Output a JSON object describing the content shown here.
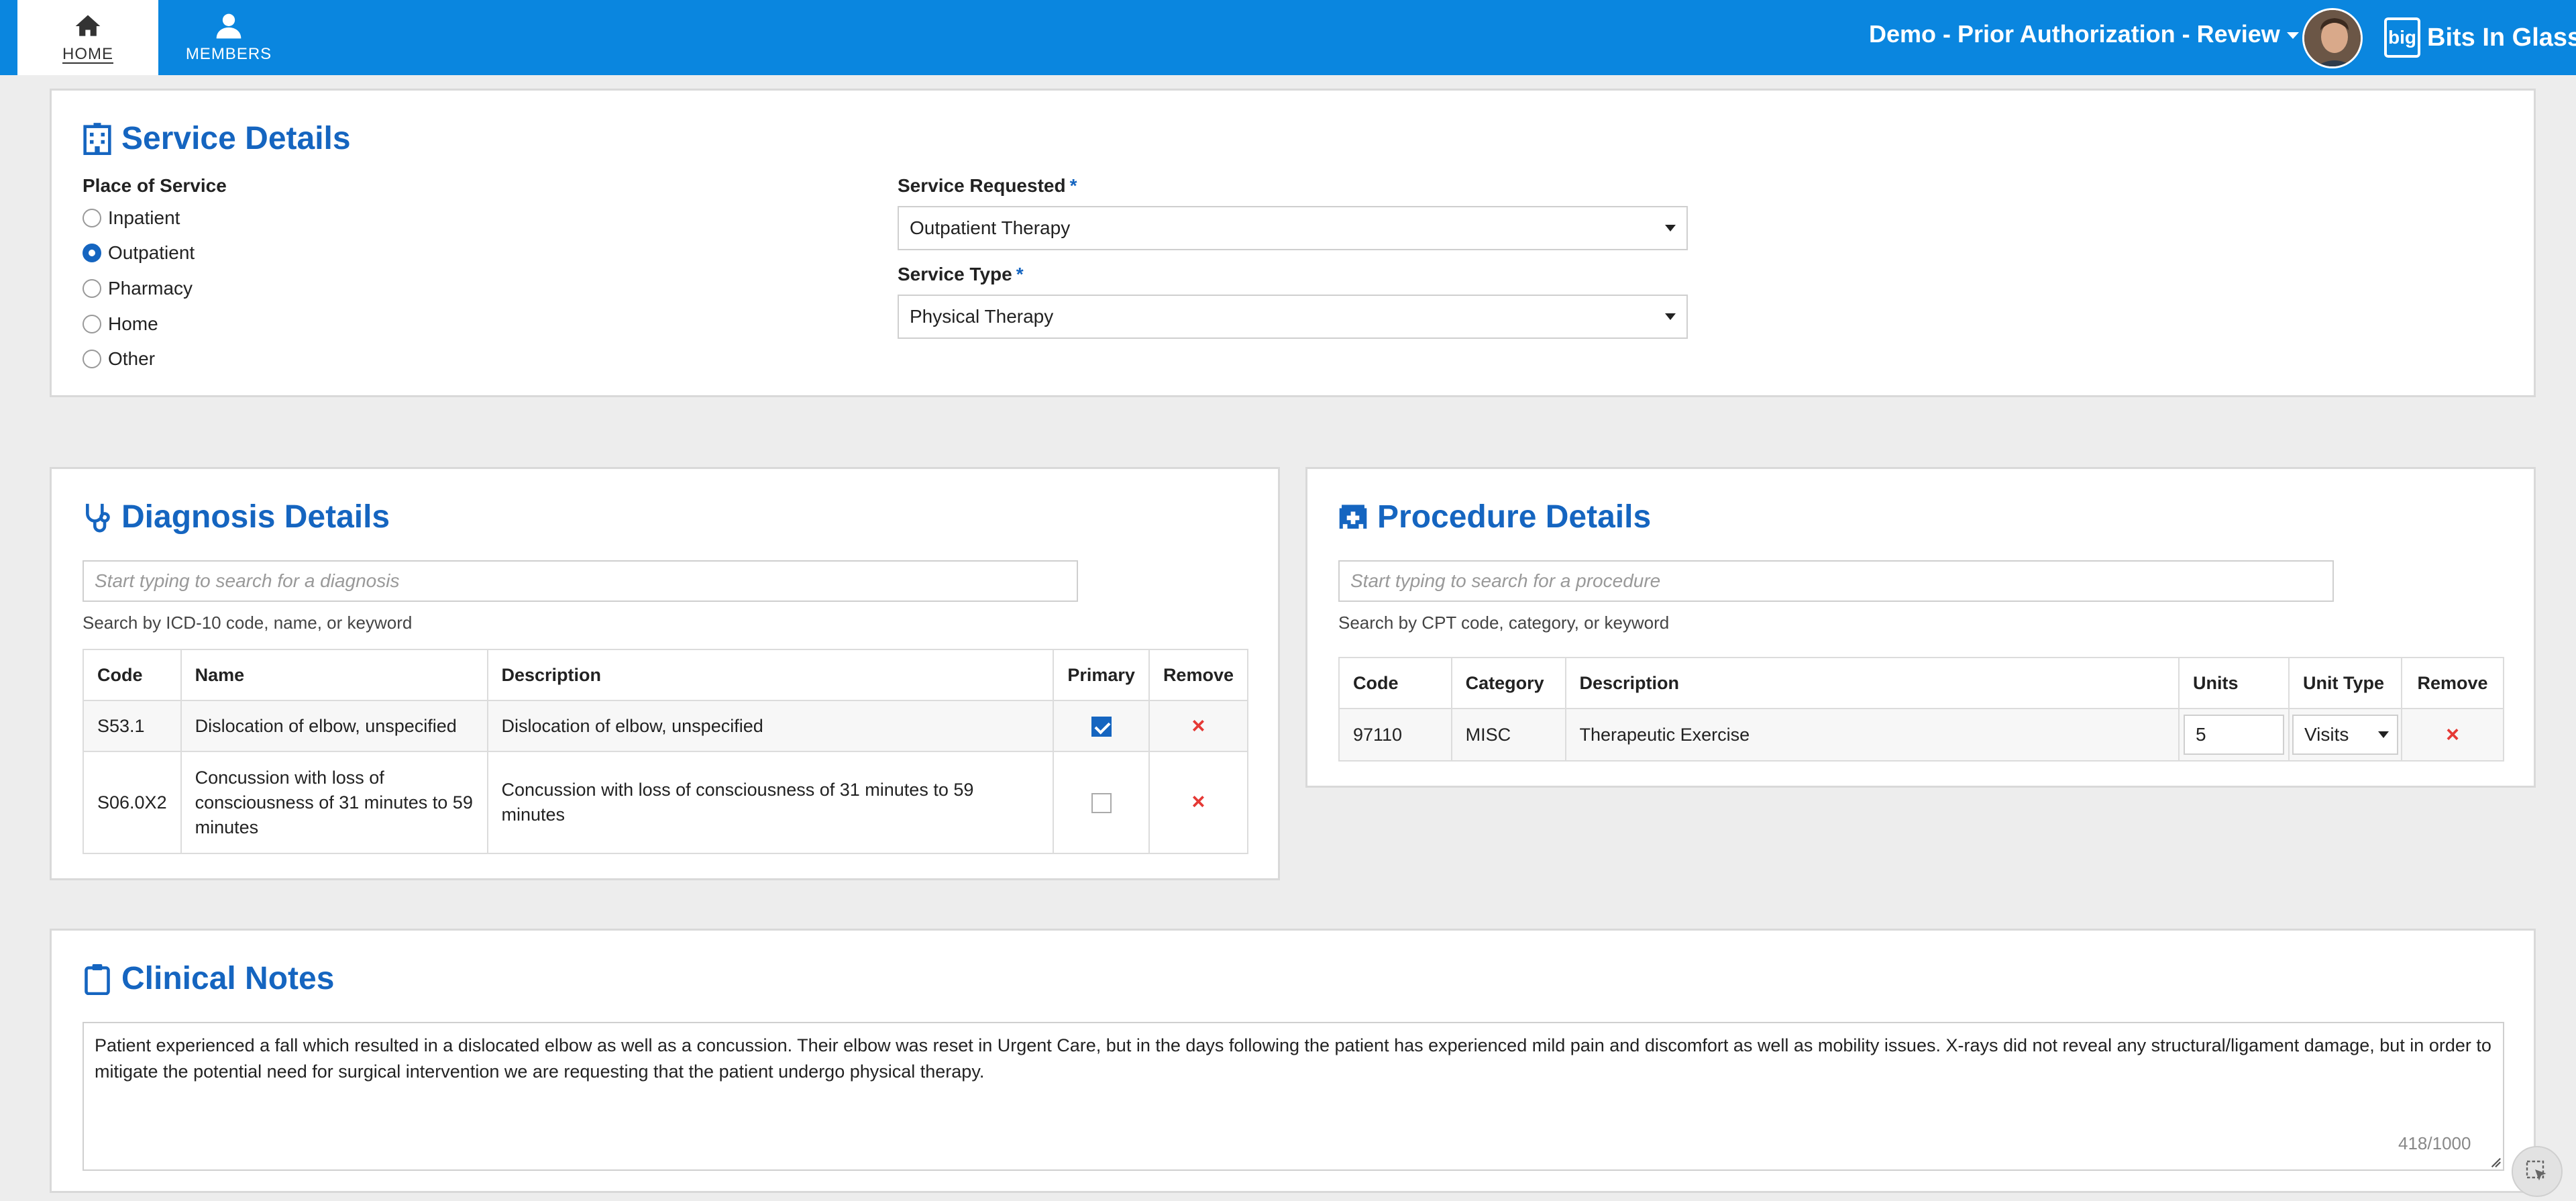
{
  "nav": {
    "home_label": "HOME",
    "members_label": "MEMBERS"
  },
  "header": {
    "app_title": "Demo - Prior Authorization - Review",
    "brand_mark": "big",
    "brand_name": "Bits In Glass"
  },
  "service": {
    "title": "Service Details",
    "place_label": "Place of Service",
    "places": [
      {
        "label": "Inpatient",
        "selected": false
      },
      {
        "label": "Outpatient",
        "selected": true
      },
      {
        "label": "Pharmacy",
        "selected": false
      },
      {
        "label": "Home",
        "selected": false
      },
      {
        "label": "Other",
        "selected": false
      }
    ],
    "requested_label": "Service Requested",
    "requested_value": "Outpatient Therapy",
    "type_label": "Service Type",
    "type_value": "Physical Therapy",
    "required_mark": "*"
  },
  "diagnosis": {
    "title": "Diagnosis Details",
    "search_placeholder": "Start typing to search for a diagnosis",
    "hint": "Search by ICD-10 code, name, or keyword",
    "columns": [
      "Code",
      "Name",
      "Description",
      "Primary",
      "Remove"
    ],
    "rows": [
      {
        "code": "S53.1",
        "name": "Dislocation of elbow, unspecified",
        "description": "Dislocation of elbow, unspecified",
        "primary": true
      },
      {
        "code": "S06.0X2",
        "name": "Concussion with loss of consciousness of 31 minutes to 59 minutes",
        "description": "Concussion with loss of consciousness of 31 minutes to 59 minutes",
        "primary": false
      }
    ]
  },
  "procedure": {
    "title": "Procedure Details",
    "search_placeholder": "Start typing to search for a procedure",
    "hint": "Search by CPT code, category, or keyword",
    "columns": [
      "Code",
      "Category",
      "Description",
      "Units",
      "Unit Type",
      "Remove"
    ],
    "rows": [
      {
        "code": "97110",
        "category": "MISC",
        "description": "Therapeutic Exercise",
        "units": "5",
        "unit_type": "Visits"
      }
    ]
  },
  "notes": {
    "title": "Clinical Notes",
    "text": "Patient experienced a fall which resulted in a dislocated elbow as well as a concussion. Their elbow was reset in Urgent Care, but in the days following the patient has experienced mild pain and discomfort as well as mobility issues. X-rays did not reveal any structural/ligament damage, but in order to mitigate the potential need for surgical intervention we are requesting that the patient undergo physical therapy.",
    "counter": "418/1000"
  },
  "icons": {
    "remove": "×"
  },
  "colors": {
    "topbar": "#0a86df",
    "accent": "#1565c0",
    "remove": "#e53935"
  }
}
